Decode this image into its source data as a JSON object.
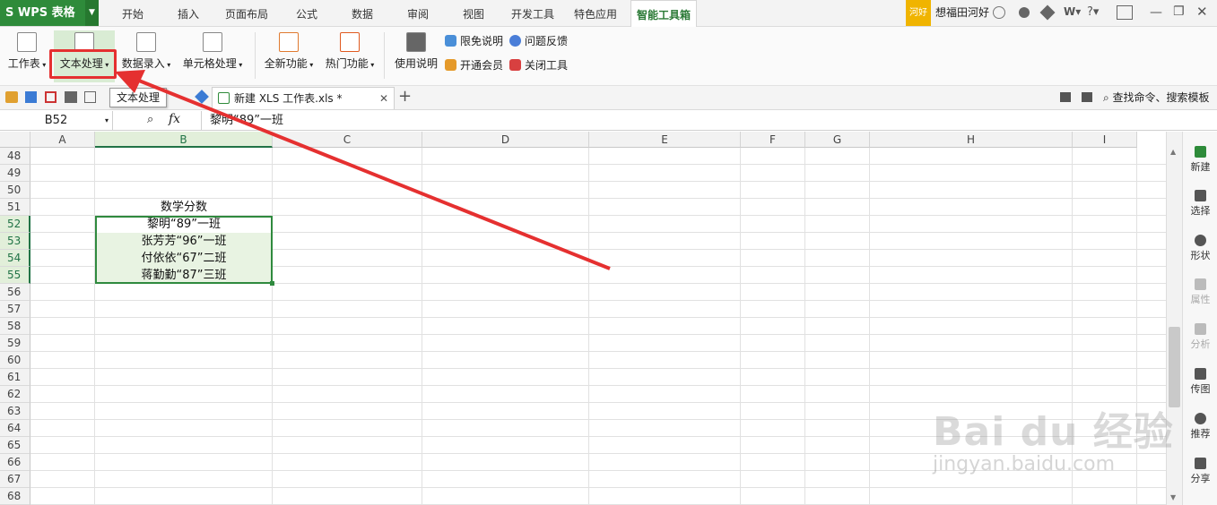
{
  "app": {
    "logo": "S WPS 表格"
  },
  "menu_tabs": [
    "开始",
    "插入",
    "页面布局",
    "公式",
    "数据",
    "审阅",
    "视图",
    "开发工具",
    "特色应用",
    "智能工具箱"
  ],
  "user": {
    "badge": "河好",
    "name": "想福田河好"
  },
  "ribbon": {
    "buttons": [
      "工作表",
      "文本处理",
      "数据录入",
      "单元格处理",
      "全新功能",
      "热门功能",
      "使用说明"
    ],
    "small": [
      "限免说明",
      "问题反馈",
      "开通会员",
      "关闭工具"
    ]
  },
  "tooltip": "文本处理",
  "document_tab": "新建 XLS 工作表.xls *",
  "search": "查找命令、搜索模板",
  "formula_bar": {
    "cell_ref": "B52",
    "fx": "fx",
    "content": "黎明“89”一班"
  },
  "columns": [
    "A",
    "B",
    "C",
    "D",
    "E",
    "F",
    "G",
    "H",
    "I"
  ],
  "rows": [
    "48",
    "49",
    "50",
    "51",
    "52",
    "53",
    "54",
    "55",
    "56",
    "57",
    "58",
    "59",
    "60",
    "61",
    "62",
    "63",
    "64",
    "65",
    "66",
    "67",
    "68"
  ],
  "cells": {
    "B51": "数学分数",
    "B52": "黎明“89”一班",
    "B53": "张芳芳“96”一班",
    "B54": "付依依“67”二班",
    "B55": "蒋勤勤“87”三班"
  },
  "side_panel": [
    "新建",
    "选择",
    "形状",
    "属性",
    "分析",
    "传图",
    "推荐",
    "分享"
  ],
  "watermark": {
    "brand": "Bai du 经验",
    "url": "jingyan.baidu.com"
  },
  "colors": {
    "accent": "#2e8b3a",
    "highlight": "#e53030",
    "selection": "#217346"
  }
}
